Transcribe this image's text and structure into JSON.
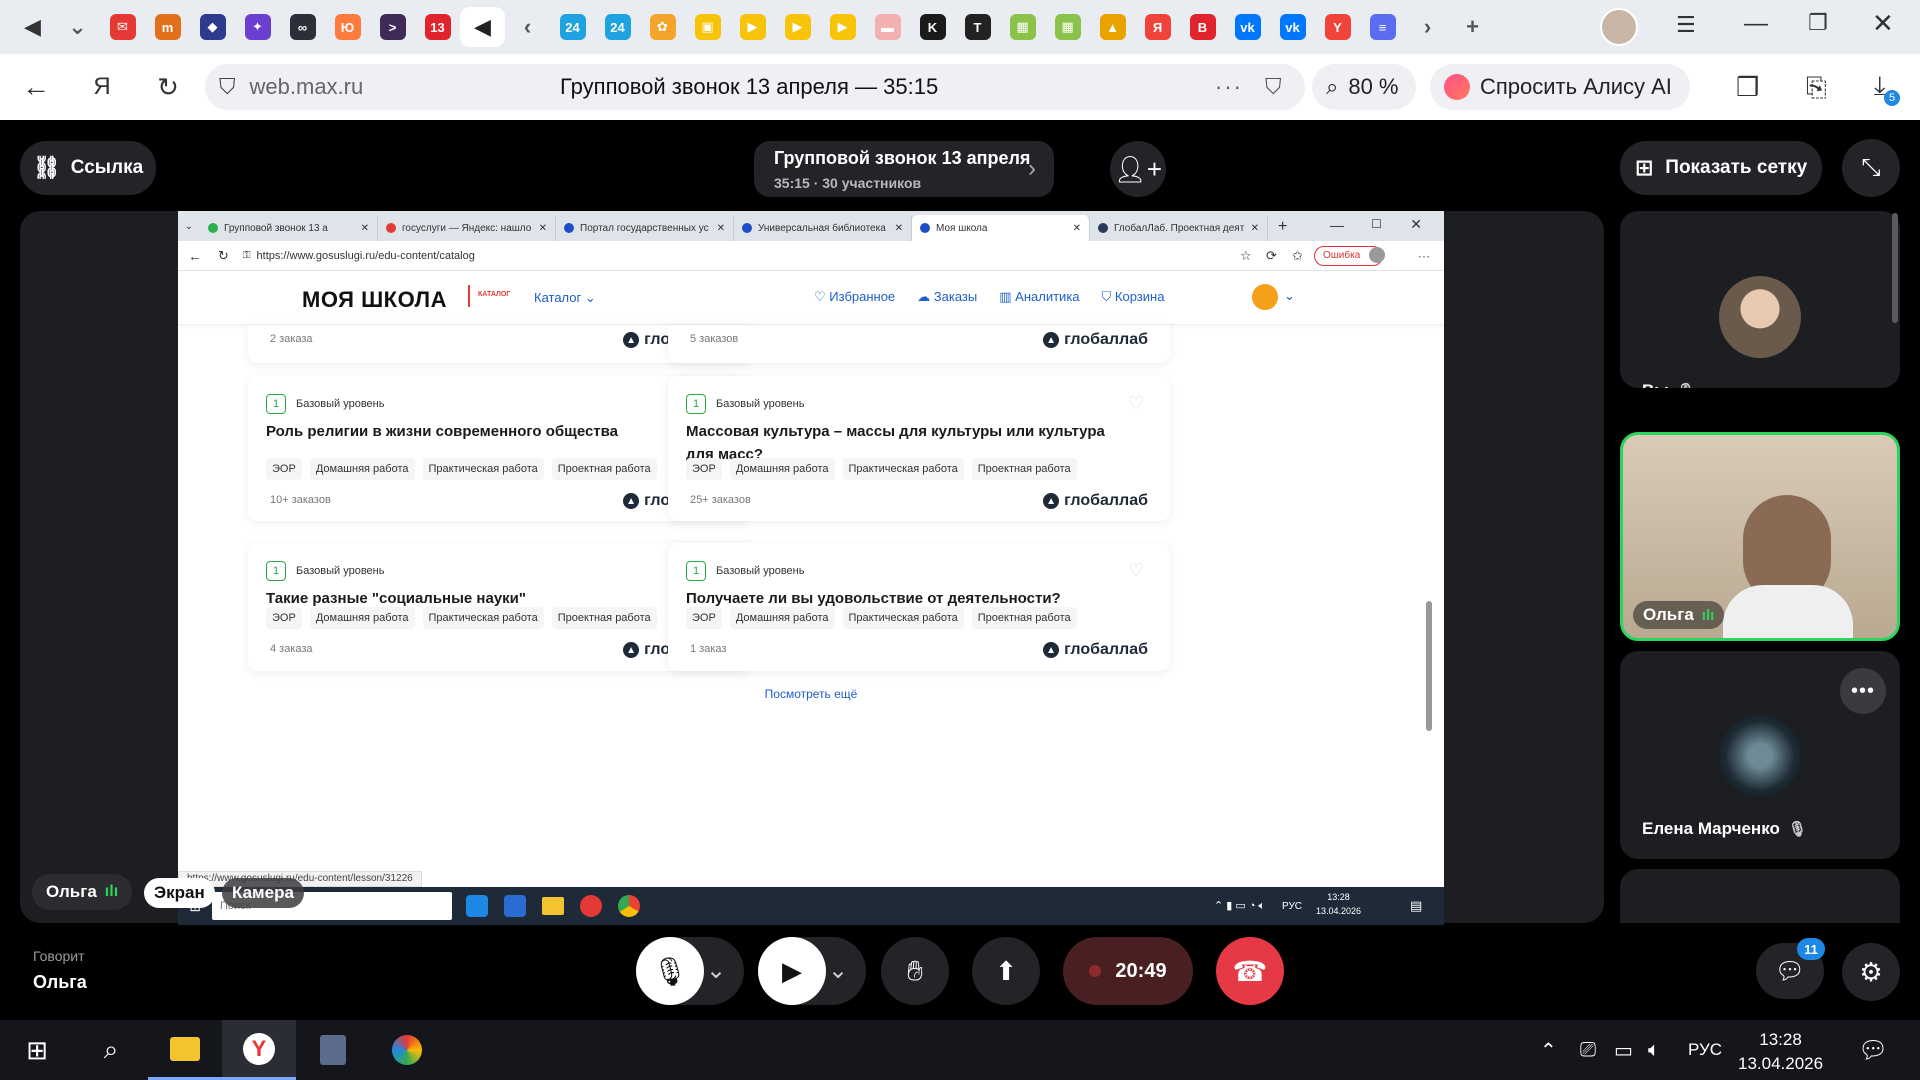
{
  "browser": {
    "url": "web.max.ru",
    "page_title": "Групповой звонок 13 апреля — 35:15",
    "zoom": "80 %",
    "alice_label": "Спросить Алису AI",
    "downloads_badge": "5",
    "tabs": [
      {
        "icon": "speaker-icon",
        "color": "#333333",
        "glyph": "◀"
      },
      {
        "icon": "chevron-down-icon",
        "color": "#555555",
        "glyph": "⌄"
      },
      {
        "icon": "mail-icon",
        "color": "#e53935",
        "glyph": "✉"
      },
      {
        "icon": "bookmark-icon",
        "color": "#e0701b",
        "glyph": "m"
      },
      {
        "icon": "logo-icon",
        "color": "#2e3a8c",
        "glyph": "◆"
      },
      {
        "icon": "star-icon",
        "color": "#6a3fd1",
        "glyph": "✦"
      },
      {
        "icon": "app-icon",
        "color": "#2a2f3a",
        "glyph": "∞"
      },
      {
        "icon": "edit-icon",
        "color": "#ff7a3d",
        "glyph": "Ю"
      },
      {
        "icon": "app-icon",
        "color": "#402a5a",
        "glyph": ">"
      },
      {
        "icon": "counter-icon",
        "color": "#e0232d",
        "glyph": "13"
      },
      {
        "icon": "speaker-icon",
        "color": "#222222",
        "glyph": "◀"
      },
      {
        "icon": "back-icon",
        "color": "#555555",
        "glyph": "‹"
      },
      {
        "icon": "news-icon",
        "color": "#1fa2e0",
        "glyph": "24"
      },
      {
        "icon": "news-icon",
        "color": "#1fa2e0",
        "glyph": "24"
      },
      {
        "icon": "photos-icon",
        "color": "#f4a42a",
        "glyph": "✿"
      },
      {
        "icon": "note-icon",
        "color": "#f7c40a",
        "glyph": "▣"
      },
      {
        "icon": "play-icon",
        "color": "#f7c40a",
        "glyph": "▶"
      },
      {
        "icon": "play-icon",
        "color": "#f7c40a",
        "glyph": "▶"
      },
      {
        "icon": "play-icon",
        "color": "#f7c40a",
        "glyph": "▶"
      },
      {
        "icon": "media-icon",
        "color": "#f2b0b0",
        "glyph": "▬"
      },
      {
        "icon": "k-icon",
        "color": "#1a1a1a",
        "glyph": "K"
      },
      {
        "icon": "t-icon",
        "color": "#222222",
        "glyph": "T"
      },
      {
        "icon": "doc-icon",
        "color": "#8bc34a",
        "glyph": "▦"
      },
      {
        "icon": "doc-icon",
        "color": "#8bc34a",
        "glyph": "▦"
      },
      {
        "icon": "image-icon",
        "color": "#e8a300",
        "glyph": "▲"
      },
      {
        "icon": "yandex-icon",
        "color": "#f0433a",
        "glyph": "Я"
      },
      {
        "icon": "vk-video-icon",
        "color": "#e0232d",
        "glyph": "В"
      },
      {
        "icon": "vk-icon",
        "color": "#0077ff",
        "glyph": "vk"
      },
      {
        "icon": "vk-icon",
        "color": "#0077ff",
        "glyph": "vk"
      },
      {
        "icon": "yandex-icon",
        "color": "#f0433a",
        "glyph": "Y"
      },
      {
        "icon": "list-icon",
        "color": "#5a6cf0",
        "glyph": "≡"
      },
      {
        "icon": "forward-icon",
        "color": "#555555",
        "glyph": "›"
      },
      {
        "icon": "plus-icon",
        "color": "#555555",
        "glyph": "+"
      }
    ]
  },
  "call": {
    "link_label": "Ссылка",
    "title": "Групповой звонок 13 апреля",
    "subtitle": "35:15 · 30 участников",
    "grid_label": "Показать сетку",
    "speaking_caption": "Говорит",
    "speaking_name": "Ольга",
    "share_owner": "Ольга",
    "screen_label": "Экран",
    "camera_label": "Камера",
    "timer": "20:49",
    "chat_badge": "11",
    "participants": [
      {
        "name": "Вы",
        "muted": true
      },
      {
        "name": "Ольга",
        "muted": false
      },
      {
        "name": "Елена Марченко",
        "muted": true
      }
    ]
  },
  "shared": {
    "tabs": [
      {
        "label": "Групповой звонок 13 а",
        "color": "#2bb24c"
      },
      {
        "label": "госуслуги — Яндекс: нашло",
        "color": "#e53935"
      },
      {
        "label": "Портал государственных ус",
        "color": "#1e4ec7"
      },
      {
        "label": "Универсальная библиотека",
        "color": "#1e4ec7"
      },
      {
        "label": "Моя школа",
        "color": "#1e4ec7"
      },
      {
        "label": "ГлобалЛаб. Проектная деят",
        "color": "#2a3a5c"
      }
    ],
    "url": "https://www.gosuslugi.ru/edu-content/catalog",
    "error_label": "Ошибка",
    "site": {
      "logo": "МОЯ ШКОЛА",
      "logo_sub": "КАТАЛОГ",
      "catalog": "Каталог",
      "nav": [
        {
          "label": "Избранное",
          "icon": "heart-icon"
        },
        {
          "label": "Заказы",
          "icon": "cloud-icon"
        },
        {
          "label": "Аналитика",
          "icon": "chart-icon"
        },
        {
          "label": "Корзина",
          "icon": "cart-icon"
        }
      ]
    },
    "top_cards": [
      {
        "orders": "2 заказа",
        "brand": "глобаллаб"
      },
      {
        "orders": "5 заказов",
        "brand": "глобаллаб"
      }
    ],
    "cards": [
      {
        "level_num": "1",
        "level": "Базовый уровень",
        "title": "Роль религии в жизни современного общества",
        "tags": [
          "ЭОР",
          "Домашняя работа",
          "Практическая работа",
          "Проектная работа"
        ],
        "orders": "10+ заказов",
        "brand": "глобаллаб"
      },
      {
        "level_num": "1",
        "level": "Базовый уровень",
        "title": "Массовая культура – массы для культуры или культура для масс?",
        "tags": [
          "ЭОР",
          "Домашняя работа",
          "Практическая работа",
          "Проектная работа"
        ],
        "orders": "25+ заказов",
        "brand": "глобаллаб"
      },
      {
        "level_num": "1",
        "level": "Базовый уровень",
        "title": "Такие разные \"социальные науки\"",
        "tags": [
          "ЭОР",
          "Домашняя работа",
          "Практическая работа",
          "Проектная работа"
        ],
        "orders": "4 заказа",
        "brand": "глобаллаб"
      },
      {
        "level_num": "1",
        "level": "Базовый уровень",
        "title": "Получаете ли вы удовольствие от деятельности?",
        "tags": [
          "ЭОР",
          "Домашняя работа",
          "Практическая работа",
          "Проектная работа"
        ],
        "orders": "1 заказ",
        "brand": "глобаллаб"
      }
    ],
    "more_label": "Посмотреть ещё",
    "status_url": "https://www.gosuslugi.ru/edu-content/lesson/31226",
    "taskbar": {
      "search_placeholder": "Поиск",
      "lang": "РУС",
      "time": "13:28",
      "date": "13.04.2026"
    }
  },
  "os": {
    "lang": "РУС",
    "time": "13:28",
    "date": "13.04.2026"
  }
}
